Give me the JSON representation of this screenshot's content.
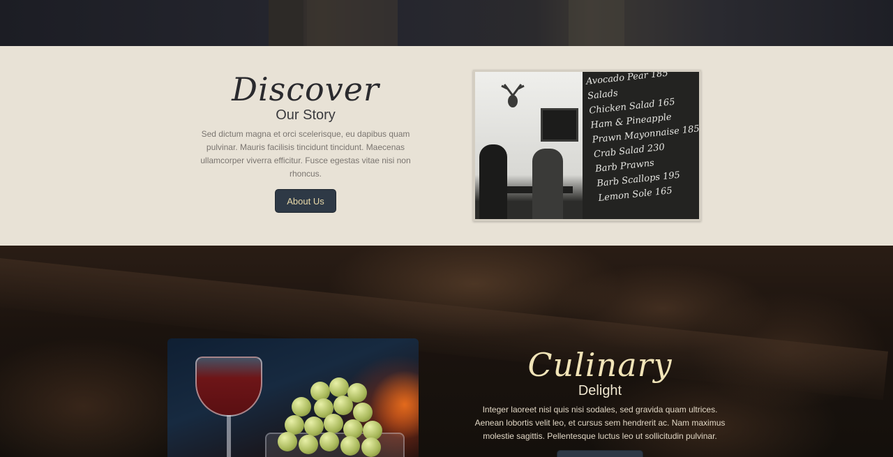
{
  "story": {
    "title": "Discover",
    "subtitle": "Our Story",
    "body": "Sed dictum magna et orci scelerisque, eu dapibus quam pulvinar. Mauris facilisis tincidunt tincidunt. Maecenas ullamcorper viverra efficitur. Fusce egestas vitae nisi non rhoncus.",
    "button_label": "About Us"
  },
  "story_photo": {
    "menu_lines": [
      "Avocado Pear 185",
      "Salads",
      "Chicken Salad 165",
      "Ham & Pineapple",
      "Prawn Mayonnaise 185",
      "Crab Salad 230",
      "Barb Prawns",
      "Barb Scallops 195",
      "Lemon Sole 165"
    ]
  },
  "culinary": {
    "title": "Culinary",
    "subtitle": "Delight",
    "body": "Integer laoreet nisl quis nisi sodales, sed gravida quam ultrices. Aenean lobortis velit leo, et cursus sem hendrerit ac. Nam maximus molestie sagittis. Pellentesque luctus leo ut sollicitudin pulvinar."
  }
}
